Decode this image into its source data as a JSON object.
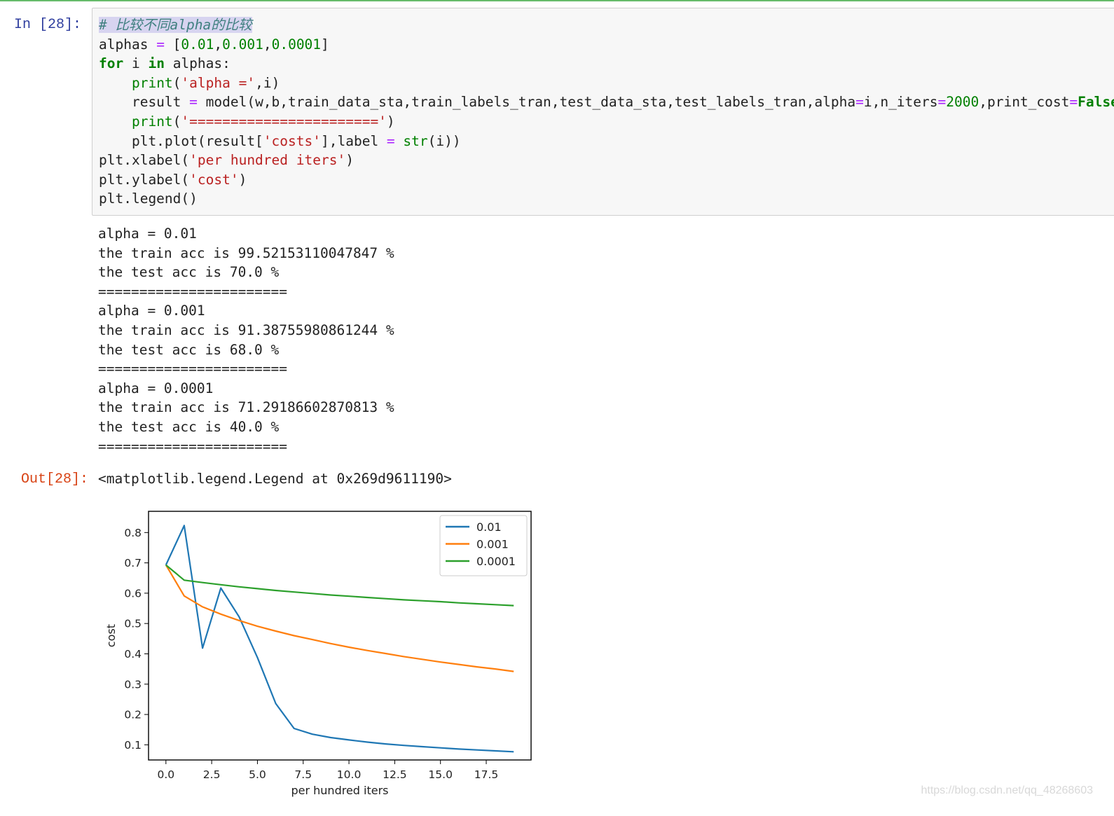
{
  "notebook": {
    "in_prompt": "In  [28]:",
    "out_prompt": "Out[28]:",
    "output_repr": "<matplotlib.legend.Legend at 0x269d9611190>"
  },
  "code_lines": [
    [
      {
        "t": "# 比较不同alpha的比较",
        "c": "c-comment"
      }
    ],
    [
      {
        "t": "alphas ",
        "c": ""
      },
      {
        "t": "=",
        "c": "c-op"
      },
      {
        "t": " [",
        "c": ""
      },
      {
        "t": "0.01",
        "c": "c-num"
      },
      {
        "t": ",",
        "c": ""
      },
      {
        "t": "0.001",
        "c": "c-num"
      },
      {
        "t": ",",
        "c": ""
      },
      {
        "t": "0.0001",
        "c": "c-num"
      },
      {
        "t": "]",
        "c": ""
      }
    ],
    [
      {
        "t": "for",
        "c": "c-kw"
      },
      {
        "t": " i ",
        "c": ""
      },
      {
        "t": "in",
        "c": "c-kw"
      },
      {
        "t": " alphas:",
        "c": ""
      }
    ],
    [
      {
        "t": "    ",
        "c": ""
      },
      {
        "t": "print",
        "c": "c-bi"
      },
      {
        "t": "(",
        "c": ""
      },
      {
        "t": "'alpha ='",
        "c": "c-str"
      },
      {
        "t": ",i)",
        "c": ""
      }
    ],
    [
      {
        "t": "    result ",
        "c": ""
      },
      {
        "t": "=",
        "c": "c-op"
      },
      {
        "t": " model(w,b,train_data_sta,train_labels_tran,test_data_sta,test_labels_tran,alpha",
        "c": ""
      },
      {
        "t": "=",
        "c": "c-op"
      },
      {
        "t": "i,n_iters",
        "c": ""
      },
      {
        "t": "=",
        "c": "c-op"
      },
      {
        "t": "2000",
        "c": "c-num"
      },
      {
        "t": ",print_cost",
        "c": ""
      },
      {
        "t": "=",
        "c": "c-op"
      },
      {
        "t": "False",
        "c": "c-kw"
      },
      {
        "t": ")",
        "c": ""
      }
    ],
    [
      {
        "t": "    ",
        "c": ""
      },
      {
        "t": "print",
        "c": "c-bi"
      },
      {
        "t": "(",
        "c": ""
      },
      {
        "t": "'======================='",
        "c": "c-str"
      },
      {
        "t": ")",
        "c": ""
      }
    ],
    [
      {
        "t": "    plt.plot(result[",
        "c": ""
      },
      {
        "t": "'costs'",
        "c": "c-str"
      },
      {
        "t": "],label ",
        "c": ""
      },
      {
        "t": "=",
        "c": "c-op"
      },
      {
        "t": " ",
        "c": ""
      },
      {
        "t": "str",
        "c": "c-bi"
      },
      {
        "t": "(i))",
        "c": ""
      }
    ],
    [
      {
        "t": "plt.xlabel(",
        "c": ""
      },
      {
        "t": "'per hundred iters'",
        "c": "c-str"
      },
      {
        "t": ")",
        "c": ""
      }
    ],
    [
      {
        "t": "plt.ylabel(",
        "c": ""
      },
      {
        "t": "'cost'",
        "c": "c-str"
      },
      {
        "t": ")",
        "c": ""
      }
    ],
    [
      {
        "t": "plt.legend()",
        "c": ""
      }
    ]
  ],
  "stdout_lines": [
    "alpha = 0.01",
    "the train acc is 99.52153110047847 %",
    "the test acc is 70.0 %",
    "=======================",
    "alpha = 0.001",
    "the train acc is 91.38755980861244 %",
    "the test acc is 68.0 %",
    "=======================",
    "alpha = 0.0001",
    "the train acc is 71.29186602870813 %",
    "the test acc is 40.0 %",
    "======================="
  ],
  "watermark": "https://blog.csdn.net/qq_48268603",
  "chart_data": {
    "type": "line",
    "title": "",
    "xlabel": "per hundred iters",
    "ylabel": "cost",
    "xlim": [
      -0.95,
      19.95
    ],
    "ylim": [
      0.05,
      0.87
    ],
    "xticks": [
      0.0,
      2.5,
      5.0,
      7.5,
      10.0,
      12.5,
      15.0,
      17.5
    ],
    "xtick_labels": [
      "0.0",
      "2.5",
      "5.0",
      "7.5",
      "10.0",
      "12.5",
      "15.0",
      "17.5"
    ],
    "yticks": [
      0.1,
      0.2,
      0.3,
      0.4,
      0.5,
      0.6,
      0.7,
      0.8
    ],
    "ytick_labels": [
      "0.1",
      "0.2",
      "0.3",
      "0.4",
      "0.5",
      "0.6",
      "0.7",
      "0.8"
    ],
    "legend_position": "top-right",
    "x": [
      0,
      1,
      2,
      3,
      4,
      5,
      6,
      7,
      8,
      9,
      10,
      11,
      12,
      13,
      14,
      15,
      16,
      17,
      18,
      19
    ],
    "series": [
      {
        "name": "0.01",
        "color": "#1f77b4",
        "values": [
          0.693,
          0.823,
          0.419,
          0.617,
          0.522,
          0.388,
          0.236,
          0.154,
          0.135,
          0.124,
          0.116,
          0.109,
          0.103,
          0.098,
          0.094,
          0.09,
          0.086,
          0.083,
          0.08,
          0.077
        ]
      },
      {
        "name": "0.001",
        "color": "#ff7f0e",
        "values": [
          0.693,
          0.591,
          0.555,
          0.531,
          0.51,
          0.491,
          0.475,
          0.46,
          0.447,
          0.434,
          0.422,
          0.411,
          0.401,
          0.391,
          0.382,
          0.373,
          0.365,
          0.357,
          0.35,
          0.342
        ]
      },
      {
        "name": "0.0001",
        "color": "#2ca02c",
        "values": [
          0.693,
          0.643,
          0.635,
          0.628,
          0.621,
          0.615,
          0.609,
          0.604,
          0.599,
          0.594,
          0.59,
          0.586,
          0.582,
          0.578,
          0.575,
          0.572,
          0.568,
          0.565,
          0.562,
          0.559
        ]
      }
    ]
  }
}
